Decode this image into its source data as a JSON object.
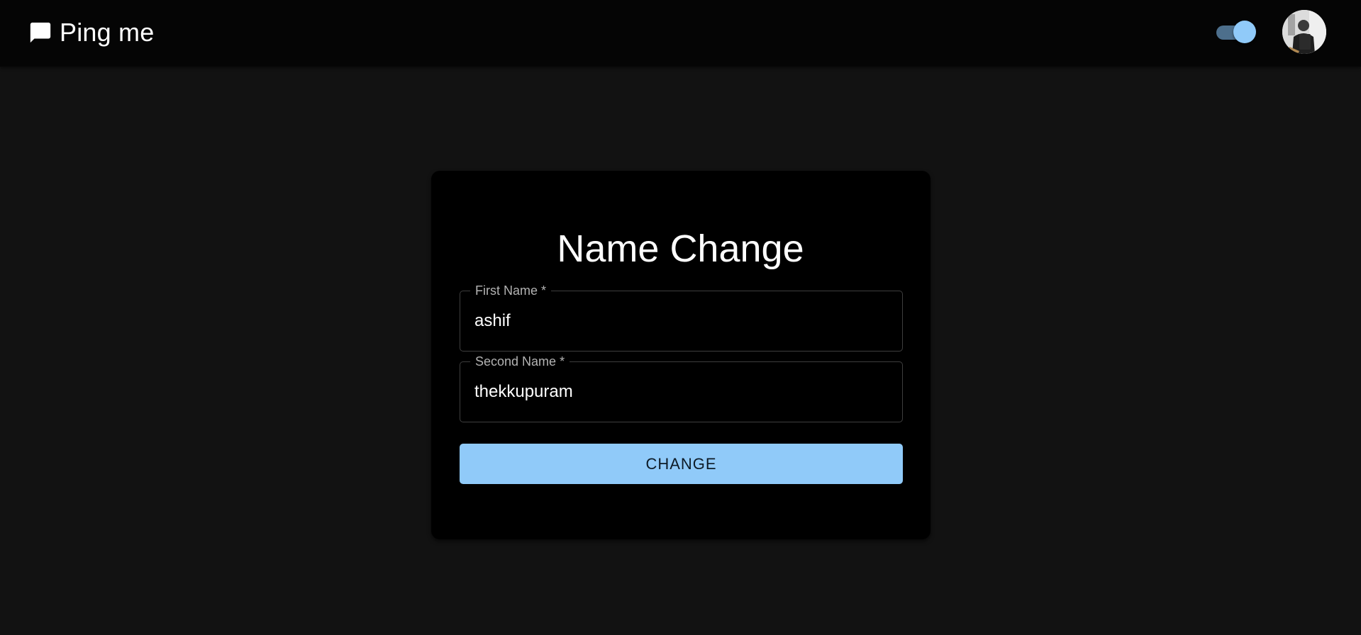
{
  "appbar": {
    "title": "Ping me",
    "brand_icon": "chat-bubble-icon",
    "theme_toggle": {
      "checked": true
    },
    "avatar_alt": "User avatar"
  },
  "form": {
    "title": "Name Change",
    "first_name": {
      "label": "First Name *",
      "value": "ashif"
    },
    "second_name": {
      "label": "Second Name *",
      "value": "thekkupuram"
    },
    "submit_label": "CHANGE"
  },
  "colors": {
    "background": "#121212",
    "appbar": "#050505",
    "card": "#000000",
    "accent": "#90caf9",
    "toggle_track": "#4d6f8c"
  }
}
